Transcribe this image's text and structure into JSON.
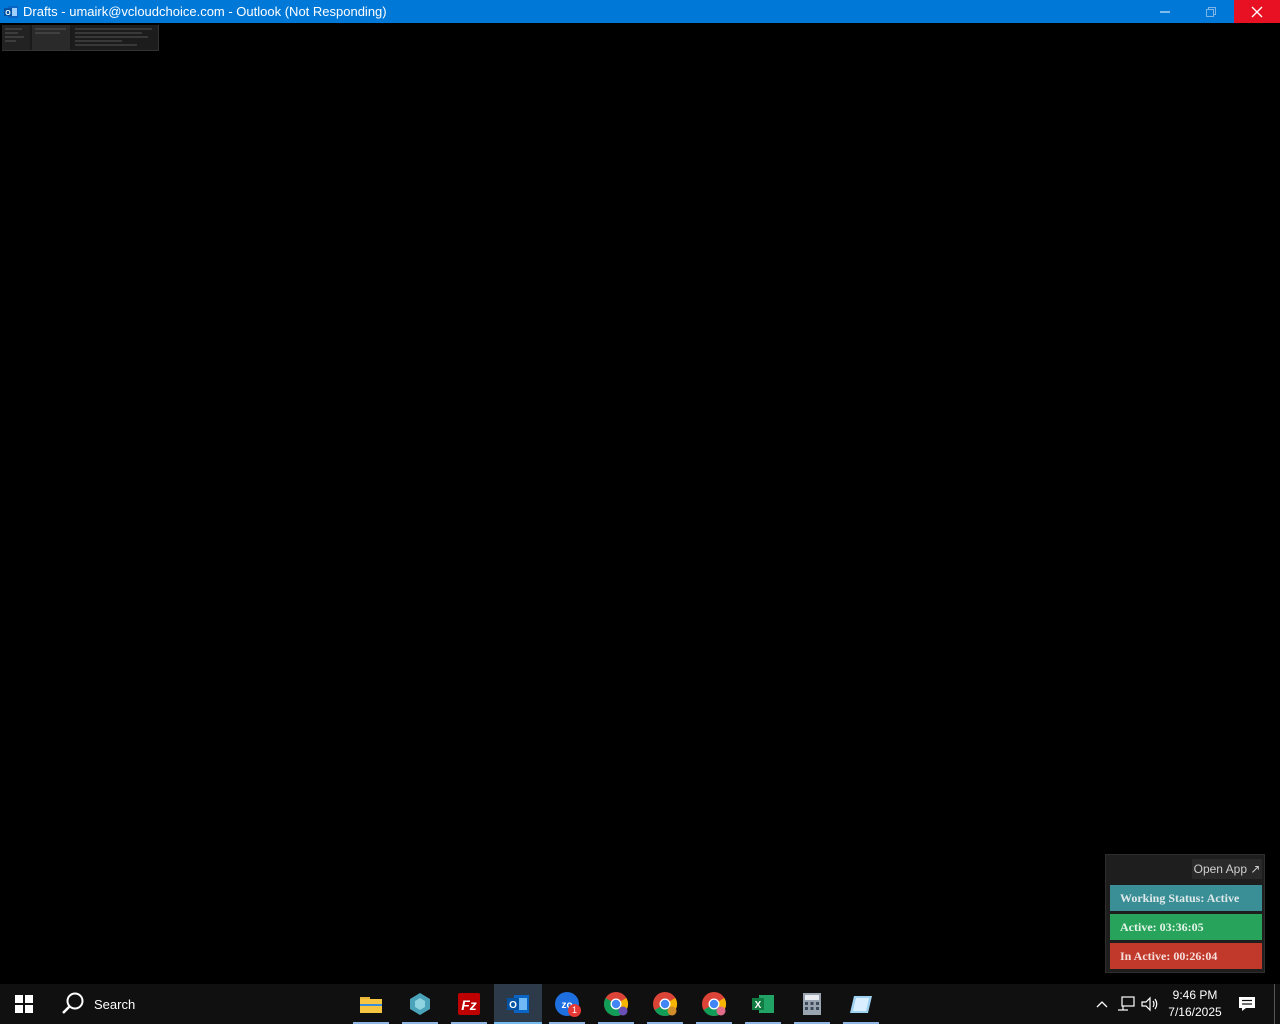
{
  "window": {
    "title": "Drafts - umairk@vcloudchoice.com - Outlook (Not Responding)",
    "app_icon": "outlook-icon",
    "title_bar_color": "#0078d7",
    "close_hover_color": "#e81123"
  },
  "tracker": {
    "open_app_label": "Open App ↗",
    "working_status": "Working Status: Active",
    "active_time": "Active: 03:36:05",
    "inactive_time": "In Active: 00:26:04",
    "colors": {
      "working": "#3a8f96",
      "active": "#27a35b",
      "inactive": "#c0392b"
    }
  },
  "taskbar": {
    "search_label": "Search",
    "apps": [
      {
        "name": "file-explorer-icon"
      },
      {
        "name": "app-icon-teal"
      },
      {
        "name": "filezilla-icon"
      },
      {
        "name": "outlook-icon",
        "active": true
      },
      {
        "name": "zoho-icon",
        "badge": "1"
      },
      {
        "name": "chrome-icon"
      },
      {
        "name": "chrome-profile-icon"
      },
      {
        "name": "chrome-profile-2-icon"
      },
      {
        "name": "excel-icon"
      },
      {
        "name": "calculator-icon"
      },
      {
        "name": "notepad-icon"
      }
    ],
    "clock_time": "9:46 PM",
    "clock_date": "7/16/2025"
  }
}
